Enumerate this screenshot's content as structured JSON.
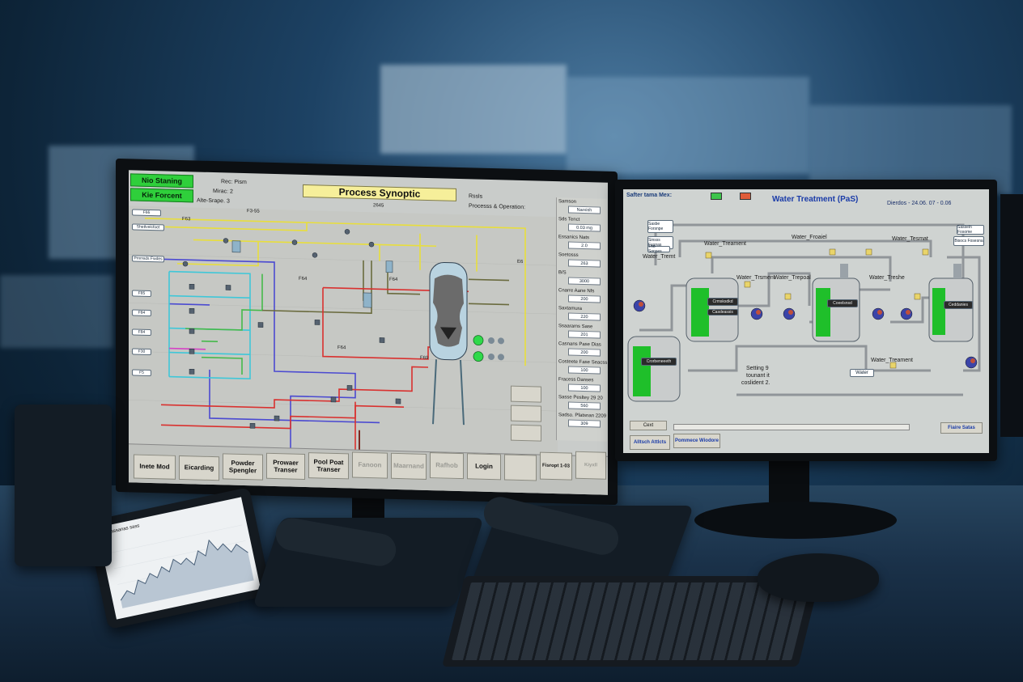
{
  "left_screen": {
    "status_1": "Nio Staning",
    "status_2": "Kie Forcent",
    "rec": "Rec: Pism",
    "mirac": "Mirac: 2",
    "alte": "Alte-Srape. 3",
    "title": "Process Synoptic",
    "subtitle_num": "2645",
    "right_header_1": "Rssls",
    "right_header_2": "Processs & Operation:",
    "valve_labels": [
      "F63",
      "F3-55",
      "F64",
      "F64",
      "F64",
      "F69",
      "E6"
    ],
    "left_tags": [
      "F66",
      "Shetlvelcfoet",
      "Prnrreds Fwdes",
      "F85",
      "F84",
      "F84",
      "F30",
      "F5"
    ],
    "panel_values": [
      {
        "label": "Samson",
        "value": "Narxish"
      },
      {
        "label": "Sds Tenct",
        "value": "0.03 mg"
      },
      {
        "label": "Essanics Nats",
        "value": "2.0"
      },
      {
        "label": "Soetosss",
        "value": "263"
      },
      {
        "label": "B/S",
        "value": "3000"
      },
      {
        "label": "Cnarre Aane Nfs",
        "value": "200"
      },
      {
        "label": "Saxtamura",
        "value": "220"
      },
      {
        "label": "Ssaarams Sase",
        "value": "201"
      },
      {
        "label": "Casnans Pase Dias",
        "value": "200"
      },
      {
        "label": "Costeete Fase Seacss",
        "value": "100"
      },
      {
        "label": "Fracess Danses",
        "value": "100"
      },
      {
        "label": "Sasse Pesltey 29 20",
        "value": "560"
      },
      {
        "label": "Sadso. Pfatsnan 2209",
        "value": "309"
      }
    ],
    "bottom_buttons": [
      {
        "label": "Inete Mod",
        "dim": false
      },
      {
        "label": "Eicarding",
        "dim": false
      },
      {
        "label": "Powder Spengler",
        "dim": false
      },
      {
        "label": "Prowaer Transer",
        "dim": false
      },
      {
        "label": "Pool Poat Transer",
        "dim": false
      },
      {
        "label": "Fanoon",
        "dim": true
      },
      {
        "label": "Maarnand",
        "dim": true
      },
      {
        "label": "Rafhob",
        "dim": true
      },
      {
        "label": "Login",
        "dim": false
      },
      {
        "label": "",
        "dim": true
      },
      {
        "label": "Fisropt 1-03",
        "dim": false
      },
      {
        "label": "Kiyxll",
        "dim": true
      }
    ]
  },
  "right_screen": {
    "top_left": "Safter tama Mex:",
    "title": "Water Treatment (PaS)",
    "date": "Dierdos - 24.06. 07 - 0.06",
    "nodes": [
      "Water_Treament",
      "Water_Tremt",
      "Water_Trsment",
      "Water_Trepoal",
      "Water_Froaiel",
      "Water_Tesmat",
      "Water_Treshe",
      "Water_Treament"
    ],
    "side_labels": [
      "Sasbe Forsnpe",
      "Sinsss Fasnas",
      "Tho Sonses",
      "Sasseln Fosome",
      "Bisocs Fosesna"
    ],
    "tank_labels": [
      "Crorbeneeeth",
      "Crmsksdkd",
      "Coeelsnsd",
      "Ceddanies",
      "Casdeassis"
    ],
    "center_text_1": "Setting 9",
    "center_text_2": "tounant it",
    "center_text_3": "coslident 2.",
    "water_tag": "Water",
    "cext_button": "Cext",
    "bottom_btn_1": "Alltsch Attlcts",
    "bottom_btn_2": "Pommece Wiodore",
    "bottom_right_btn": "Fiaire Satas"
  },
  "tablet": {
    "title": "Pnassanas sass"
  },
  "colors": {
    "screen_bg": "#c9ccca",
    "green_status": "#2fcf3b",
    "title_yellow": "#f6ef9a",
    "pipe_red": "#d9312f",
    "pipe_blue": "#4b4ad1",
    "pipe_cyan": "#3fc7d8",
    "pipe_yellow": "#e8de3c",
    "pipe_green": "#45b94a",
    "pipe_olive": "#6a6b3e",
    "tank_green": "#1fbf2a"
  }
}
